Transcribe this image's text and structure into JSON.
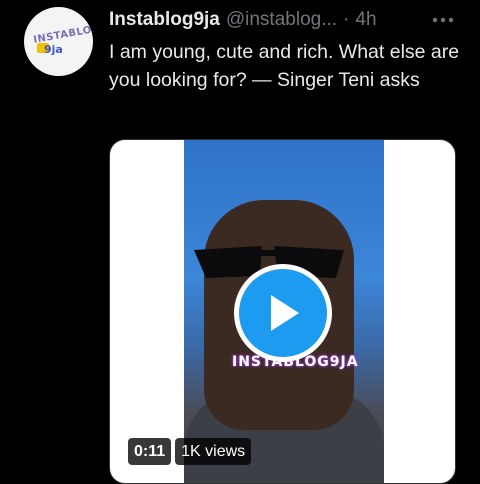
{
  "tweet": {
    "author_name": "Instablog9ja",
    "author_handle": "@instablog...",
    "separator": "·",
    "time": "4h",
    "text": "I am young, cute and rich. What else are you looking for? — Singer Teni asks",
    "more_icon": "more-horizontal-icon"
  },
  "avatar": {
    "text_top": "INSTABLOG",
    "text_bottom": "9ja"
  },
  "media": {
    "watermark": "INSTABLOG9JA",
    "play_icon": "play-icon",
    "duration": "0:11",
    "views": "1K views",
    "accent_color": "#1d9bf0"
  }
}
